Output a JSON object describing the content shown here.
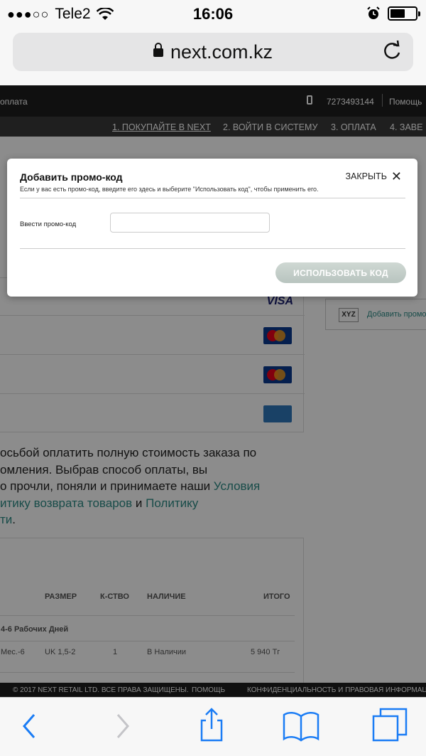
{
  "status_bar": {
    "carrier": "Tele2",
    "signal": "●●●○○",
    "time": "16:06"
  },
  "browser": {
    "url": "next.com.kz",
    "toolbar_icons": [
      "back-icon",
      "forward-icon",
      "share-icon",
      "bookmarks-icon",
      "tabs-icon"
    ]
  },
  "site": {
    "top_left_text": "оплата",
    "phone": "7273493144",
    "help": "Помощь",
    "steps": [
      "1. ПОКУПАЙТЕ В NEXT",
      "2. ВОЙТИ В СИСТЕМУ",
      "3. ОПЛАТА",
      "4. ЗАВЕ"
    ],
    "visa_label": "VISA",
    "promo_side_badge": "XYZ",
    "promo_side_link": "Добавить промо",
    "terms": {
      "line1": "осьбой оплатить полную стоимость заказа по",
      "line2": "омления. Выбрав способ оплаты, вы",
      "line3_text": "о прочли, поняли и принимаете наши ",
      "line3_link": "Условия",
      "line4_link": "итику возврата товаров",
      "line4_and": " и ",
      "line4_link2": "Политику",
      "line5_link": "ти",
      "line5_end": "."
    },
    "order_table": {
      "headers": [
        "РАЗМЕР",
        "К-СТВО",
        "НАЛИЧИЕ",
        "ИТОГО"
      ],
      "delivery": "4-6 Рабочих Дней",
      "row": {
        "desc": "Мес.-6",
        "size": "UK 1,5-2",
        "qty": "1",
        "availability": "В Наличии",
        "total": "5 940 Тг"
      }
    },
    "footer": {
      "copyright": "© 2017 NEXT RETAIL LTD. ВСЕ ПРАВА ЗАЩИЩЕНЫ.",
      "help": "ПОМОЩЬ",
      "privacy": "КОНФИДЕНЦИАЛЬНОСТЬ И ПРАВОВАЯ ИНФОРМАЦ"
    }
  },
  "modal": {
    "title": "Добавить промо-код",
    "subtitle": "Если у вас есть промо-код, введите его здесь и выберите \"Использовать код\", чтобы применить его.",
    "close_label": "ЗАКРЫТЬ",
    "input_label": "Ввести промо-код",
    "input_value": "",
    "input_placeholder": "",
    "submit_label": "ИСПОЛЬЗОВАТЬ КОД"
  },
  "colors": {
    "link": "#2c8a86",
    "header_bg": "#1e1e1e",
    "button_bg": "#c4cec9"
  }
}
